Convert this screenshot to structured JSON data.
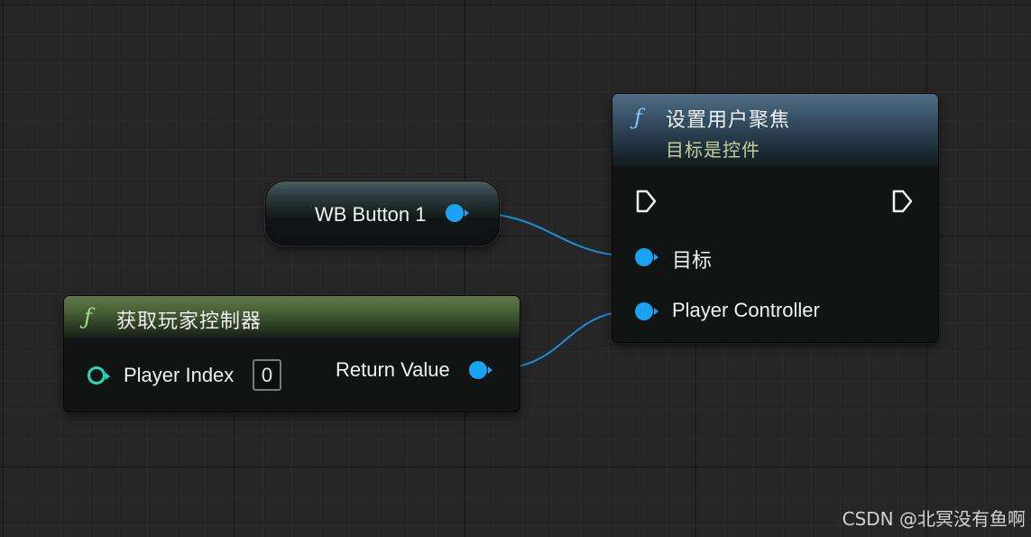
{
  "nodes": {
    "set_focus": {
      "title": "设置用户聚焦",
      "subtitle": "目标是控件",
      "target_pin": "目标",
      "player_controller_pin": "Player Controller"
    },
    "get_player_controller": {
      "title": "获取玩家控制器",
      "player_index_pin": "Player Index",
      "player_index_value": "0",
      "return_pin": "Return Value"
    },
    "variable_getter": {
      "label": "WB Button 1"
    }
  },
  "icons": {
    "function": "ƒ",
    "exec": "exec-arrow-icon",
    "object_pin": "object-pin-icon",
    "int_pin": "int-pin-icon"
  },
  "colors": {
    "object_pin": "#1aa3f2",
    "int_pin": "#1fdcb8",
    "function_icon_blue": "#7fc4ff",
    "function_icon_green": "#9ee08a",
    "subtitle": "#c6cf98",
    "wire": "#1a8fd8"
  },
  "watermark": "CSDN @北冥没有鱼啊"
}
